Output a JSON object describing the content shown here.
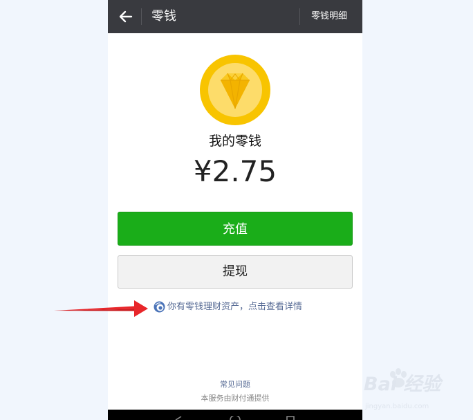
{
  "header": {
    "title": "零钱",
    "action_label": "零钱明细",
    "back_icon": "arrow-left-icon"
  },
  "wallet": {
    "coin_icon": "diamond-coin-icon",
    "label": "我的零钱",
    "amount": "¥2.75"
  },
  "actions": {
    "recharge_label": "充值",
    "withdraw_label": "提现"
  },
  "notice": {
    "icon": "wealth-fund-icon",
    "text": "你有零钱理财资产，点击查看详情"
  },
  "footer": {
    "faq_label": "常见问题",
    "provider_text": "本服务由财付通提供"
  },
  "watermark": {
    "brand": "Bai 经验",
    "url": "jingyan.baidu.com"
  },
  "colors": {
    "header_bg": "#393a3f",
    "primary_green": "#1aad19",
    "link_blue": "#576b95",
    "coin_gold": "#f8c400",
    "annotation_red": "#e8262a"
  }
}
